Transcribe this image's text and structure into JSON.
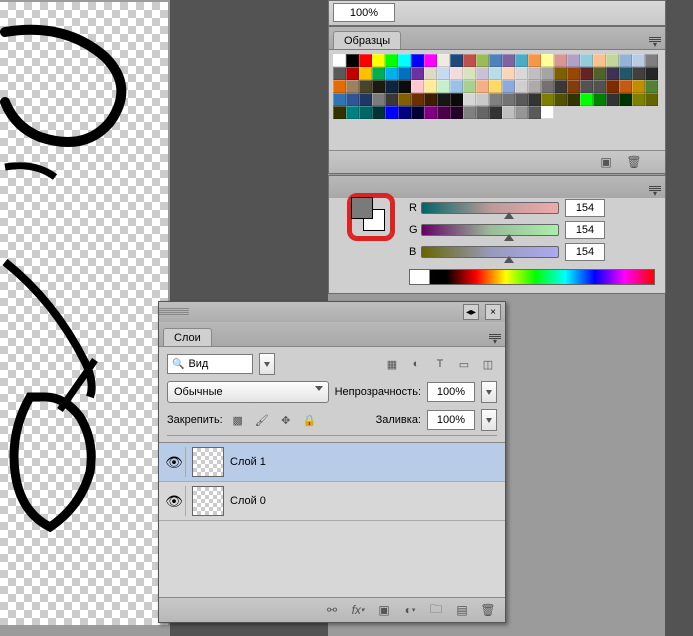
{
  "zoom": "100%",
  "swatches_panel": {
    "title": "Образцы"
  },
  "color_panel": {
    "r": 154,
    "g": 154,
    "b": 154,
    "labels": {
      "r": "R",
      "g": "G",
      "b": "B"
    }
  },
  "layers_panel": {
    "title": "Слои",
    "search_label": "Вид",
    "blend_mode": "Обычные",
    "opacity_label": "Непрозрачность:",
    "opacity": "100%",
    "fill_label": "Заливка:",
    "fill": "100%",
    "lock_label": "Закрепить:",
    "layers": [
      {
        "name": "Слой 1",
        "selected": true
      },
      {
        "name": "Слой 0",
        "selected": false
      }
    ]
  },
  "swatch_colors": [
    "#ffffff",
    "#000000",
    "#ff0000",
    "#ffff00",
    "#00ff00",
    "#00ffff",
    "#0000ff",
    "#ff00ff",
    "#eeece1",
    "#1f497d",
    "#c0504d",
    "#9bbb59",
    "#4f81bd",
    "#8064a2",
    "#4bacc6",
    "#f79646",
    "#ffff99",
    "#d99694",
    "#b2a1c7",
    "#92cddc",
    "#fac08f",
    "#c3d69b",
    "#95b3d7",
    "#b8cce4",
    "#7f7f7f",
    "#595959",
    "#c00000",
    "#ffc000",
    "#00b050",
    "#00b0f0",
    "#0070c0",
    "#7030a0",
    "#ddd9c3",
    "#c6d9f0",
    "#f2dcdb",
    "#d7e3bc",
    "#ccc0d9",
    "#b6dde8",
    "#fbd5b5",
    "#d8d8d8",
    "#bfbfbf",
    "#a5a5a5",
    "#7f6000",
    "#974706",
    "#632423",
    "#4f6228",
    "#3f3151",
    "#205867",
    "#404040",
    "#262626",
    "#e36c09",
    "#9d8161",
    "#494429",
    "#1d1b10",
    "#0f243e",
    "#0c0c0c",
    "#ffc7ce",
    "#ffeb9c",
    "#c6efce",
    "#9bc2e6",
    "#a9d08e",
    "#f4b084",
    "#ffd966",
    "#8ea9db",
    "#d0cece",
    "#aeaaaa",
    "#757171",
    "#3a3838",
    "#833c0c",
    "#525252",
    "#525252",
    "#7b2d00",
    "#c55a11",
    "#bf8f00",
    "#548235",
    "#2f75b5",
    "#305496",
    "#203764",
    "#7b7b7b",
    "#3b3838",
    "#806000",
    "#6e2f00",
    "#3c1e00",
    "#161616",
    "#0a0a0a",
    "#d6d6d6",
    "#c9c9c9",
    "#808080",
    "#737373",
    "#595959",
    "#333333",
    "#7f7f00",
    "#525200",
    "#333300",
    "#00ff00",
    "#008000",
    "#333333",
    "#003300",
    "#808000",
    "#666600",
    "#333300",
    "#008080",
    "#006666",
    "#003333",
    "#0000ff",
    "#000080",
    "#000033",
    "#800080",
    "#4c004c",
    "#260026",
    "#808080",
    "#666666",
    "#333333",
    "#c0c0c0",
    "#969696",
    "#5a5a5a",
    "#ffffff"
  ]
}
